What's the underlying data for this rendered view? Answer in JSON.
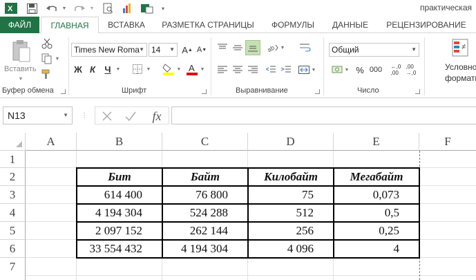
{
  "title": "практическая",
  "tabs": [
    "ФАЙЛ",
    "ГЛАВНАЯ",
    "ВСТАВКА",
    "РАЗМЕТКА СТРАНИЦЫ",
    "ФОРМУЛЫ",
    "ДАННЫЕ",
    "РЕЦЕНЗИРОВАНИЕ"
  ],
  "ribbon": {
    "paste_label": "Вставить",
    "font_name": "Times New Roma",
    "font_size": "14",
    "bold": "Ж",
    "italic": "К",
    "underline": "Ч",
    "number_format": "Общий",
    "percent": "%",
    "thousands": "000",
    "conditional_line1": "Условно",
    "conditional_line2": "форматиров",
    "groups": [
      "Буфер обмена",
      "Шрифт",
      "Выравнивание",
      "Число"
    ]
  },
  "formula_bar": {
    "name_box": "N13",
    "fx": "fx",
    "value": ""
  },
  "sheet": {
    "columns": [
      "A",
      "B",
      "C",
      "D",
      "E",
      "F"
    ],
    "rows": [
      "1",
      "2",
      "3",
      "4",
      "5",
      "6",
      "7"
    ],
    "table": {
      "headers": [
        "Бит",
        "Байт",
        "Килобайт",
        "Мегабайт"
      ],
      "data": [
        [
          "614 400",
          "76 800",
          "75",
          "0,073"
        ],
        [
          "4 194 304",
          "524 288",
          "512",
          "0,5"
        ],
        [
          "2 097 152",
          "262 144",
          "256",
          "0,25"
        ],
        [
          "33 554 432",
          "4 194 304",
          "4 096",
          "4"
        ]
      ]
    }
  },
  "colors": {
    "accent": "#217346",
    "grid": "#e1e1e1"
  }
}
